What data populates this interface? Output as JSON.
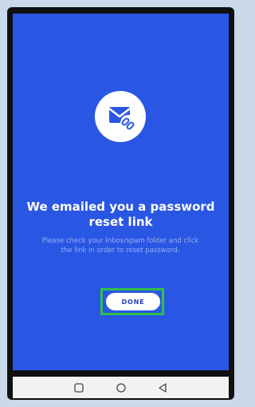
{
  "screen": {
    "background_color": "#2a56e4",
    "icon": "email-link-icon",
    "headline": "We emailed you a password reset link",
    "message": "Please check your Inbox/spam folder and click the link in order to reset password."
  },
  "actions": {
    "done_label": "DONE",
    "done_highlight_color": "#2fc04a"
  },
  "navigation_bar": {
    "buttons": [
      {
        "name": "recents",
        "icon": "square-icon"
      },
      {
        "name": "home",
        "icon": "circle-icon"
      },
      {
        "name": "back",
        "icon": "triangle-back-icon"
      }
    ]
  }
}
